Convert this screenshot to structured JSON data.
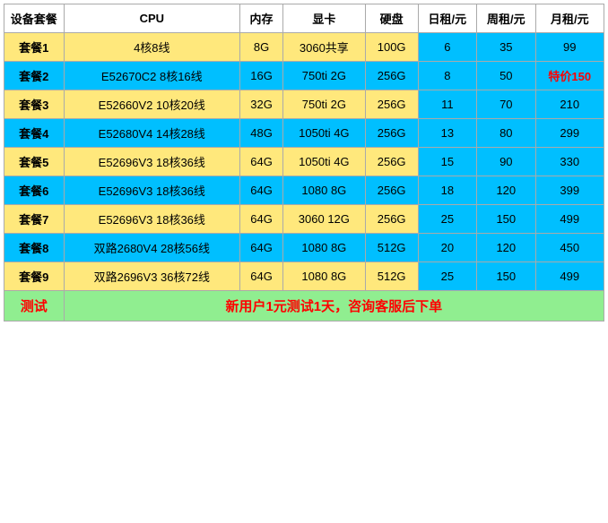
{
  "headers": {
    "package": "设备套餐",
    "cpu": "CPU",
    "mem": "内存",
    "gpu": "显卡",
    "disk": "硬盘",
    "daily": "日租/元",
    "weekly": "周租/元",
    "monthly": "月租/元"
  },
  "rows": [
    {
      "id": "套餐1",
      "cpu": "4核8线",
      "mem": "8G",
      "gpu": "3060共享",
      "disk": "100G",
      "daily": "6",
      "weekly": "35",
      "monthly": "99",
      "special": false
    },
    {
      "id": "套餐2",
      "cpu": "E52670C2 8核16线",
      "mem": "16G",
      "gpu": "750ti 2G",
      "disk": "256G",
      "daily": "8",
      "weekly": "50",
      "monthly": "特价150",
      "special": true
    },
    {
      "id": "套餐3",
      "cpu": "E52660V2 10核20线",
      "mem": "32G",
      "gpu": "750ti 2G",
      "disk": "256G",
      "daily": "11",
      "weekly": "70",
      "monthly": "210",
      "special": false
    },
    {
      "id": "套餐4",
      "cpu": "E52680V4 14核28线",
      "mem": "48G",
      "gpu": "1050ti 4G",
      "disk": "256G",
      "daily": "13",
      "weekly": "80",
      "monthly": "299",
      "special": false
    },
    {
      "id": "套餐5",
      "cpu": "E52696V3 18核36线",
      "mem": "64G",
      "gpu": "1050ti 4G",
      "disk": "256G",
      "daily": "15",
      "weekly": "90",
      "monthly": "330",
      "special": false
    },
    {
      "id": "套餐6",
      "cpu": "E52696V3 18核36线",
      "mem": "64G",
      "gpu": "1080 8G",
      "disk": "256G",
      "daily": "18",
      "weekly": "120",
      "monthly": "399",
      "special": false
    },
    {
      "id": "套餐7",
      "cpu": "E52696V3 18核36线",
      "mem": "64G",
      "gpu": "3060 12G",
      "disk": "256G",
      "daily": "25",
      "weekly": "150",
      "monthly": "499",
      "special": false
    },
    {
      "id": "套餐8",
      "cpu": "双路2680V4 28核56线",
      "mem": "64G",
      "gpu": "1080 8G",
      "disk": "512G",
      "daily": "20",
      "weekly": "120",
      "monthly": "450",
      "special": false
    },
    {
      "id": "套餐9",
      "cpu": "双路2696V3 36核72线",
      "mem": "64G",
      "gpu": "1080 8G",
      "disk": "512G",
      "daily": "25",
      "weekly": "150",
      "monthly": "499",
      "special": false
    }
  ],
  "test_row": {
    "label": "测试",
    "text": "新用户1元测试1天，咨询客服后下单"
  }
}
